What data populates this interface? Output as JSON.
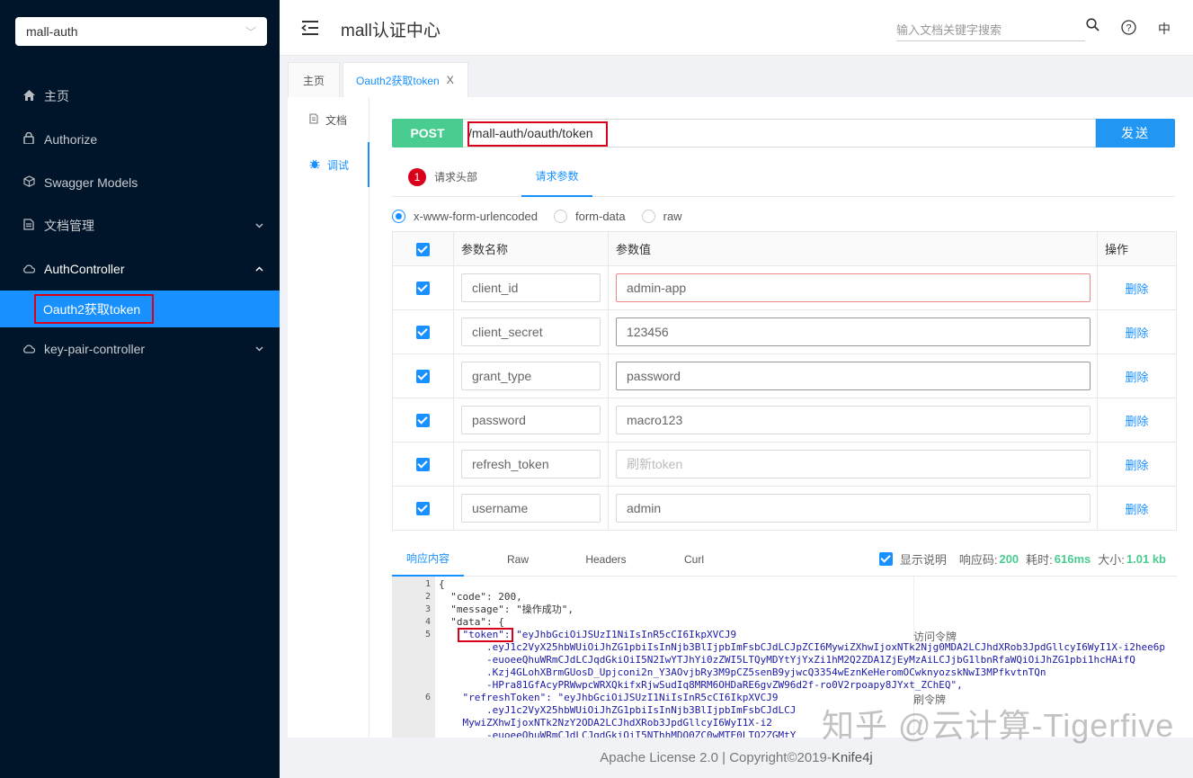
{
  "sidebar": {
    "project": "mall-auth",
    "menu": [
      {
        "label": "主页",
        "icon": "home-icon"
      },
      {
        "label": "Authorize",
        "icon": "lock-icon"
      },
      {
        "label": "Swagger Models",
        "icon": "cube-icon"
      },
      {
        "label": "文档管理",
        "icon": "doc-icon"
      },
      {
        "label": "AuthController",
        "icon": "cloud-icon"
      },
      {
        "label": "key-pair-controller",
        "icon": "cloud-icon"
      }
    ],
    "active_sub": "Oauth2获取token"
  },
  "header": {
    "title": "mall认证中心",
    "search_placeholder": "输入文档关键字搜索",
    "lang": "中"
  },
  "tabs": [
    {
      "label": "主页"
    },
    {
      "label": "Oauth2获取token",
      "close": "X"
    }
  ],
  "vtabs": [
    {
      "label": "文档"
    },
    {
      "label": "调试"
    }
  ],
  "request": {
    "method": "POST",
    "url": "/mall-auth/oauth/token",
    "send": "发送",
    "tabs": {
      "header_badge": "1",
      "headers": "请求头部",
      "params": "请求参数"
    },
    "content_types": [
      "x-www-form-urlencoded",
      "form-data",
      "raw"
    ],
    "table": {
      "headers": [
        "参数名称",
        "参数值",
        "操作"
      ],
      "rows": [
        {
          "name": "client_id",
          "value": "admin-app",
          "action": "删除"
        },
        {
          "name": "client_secret",
          "value": "123456",
          "action": "删除"
        },
        {
          "name": "grant_type",
          "value": "password",
          "action": "删除"
        },
        {
          "name": "password",
          "value": "macro123",
          "action": "删除"
        },
        {
          "name": "refresh_token",
          "value": "刷新token",
          "action": "删除"
        },
        {
          "name": "username",
          "value": "admin",
          "action": "删除"
        }
      ]
    }
  },
  "response": {
    "tabs": [
      "响应内容",
      "Raw",
      "Headers",
      "Curl"
    ],
    "show_desc": "显示说明",
    "code_label": "响应码:",
    "code": "200",
    "time_label": "耗时:",
    "time": "616ms",
    "size_label": "大小:",
    "size": "1.01 kb",
    "line_numbers": [
      "1",
      "2",
      "3",
      "4",
      "5",
      "6"
    ],
    "lines": [
      "{",
      "  \"code\": 200,",
      "  \"message\": \"操作成功\",",
      "  \"data\": {",
      "    \"token\": \"eyJhbGciOiJSUzI1NiIsInR5cCI6IkpXVCJ9",
      "        .eyJ1c2VyX25hbWUiOiJhZG1pbiIsInNjb3BlIjpbImFsbCJdLCJpZCI6MywiZXhwIjoxNTk2Njg0MDA2LCJhdXRob3JpdGllcyI6WyI1X-i2hee6p",
      "        -euoeeQhuWRmCJdLCJqdGkiOiI5N2IwYTJhYi0zZWI5LTQyMDYtYjYxZi1hM2Q2ZDA1ZjEyMzAiLCJjbG1lbnRfaWQiOiJhZG1pbi1hcHAifQ",
      "        .Kzj4GLohXBrmGUosD_Upjconi2n_Y3AOvjbRy3M9pCZ5senB9yjwcQ3354wEznKeHeromOCwknyozskNwI3MPfkvtnTQn",
      "        -HPra81GfAcyPRWwpcWRXQkifxRjwSudIq8MRM6OHDaRE6gvZW96d2f-ro0V2rpoapy8JYxt_ZChEQ\",",
      "    \"refreshToken\": \"eyJhbGciOiJSUzI1NiIsInR5cCI6IkpXVCJ9",
      "        .eyJ1c2VyX25hbWUiOiJhZG1pbiIsInNjb3BlIjpbImFsbCJdLCJ",
      "    MywiZXhwIjoxNTk2NzY2ODA2LCJhdXRob3JpdGllcyI6WyI1X-i2",
      "        -euoeeQhuWRmCJdLCJqdGkiOiI5NThhMDQ0ZC0wMTE0LTQ2ZGMtY"
    ],
    "annot_token": "访问令牌",
    "annot_refresh": "刷令牌"
  },
  "footer": {
    "prefix": "Apache License 2.0 | Copyright ",
    "copyright": "©",
    "year": " 2019-",
    "brand": "Knife4j"
  },
  "watermark": "知乎 @云计算-Tigerfive"
}
